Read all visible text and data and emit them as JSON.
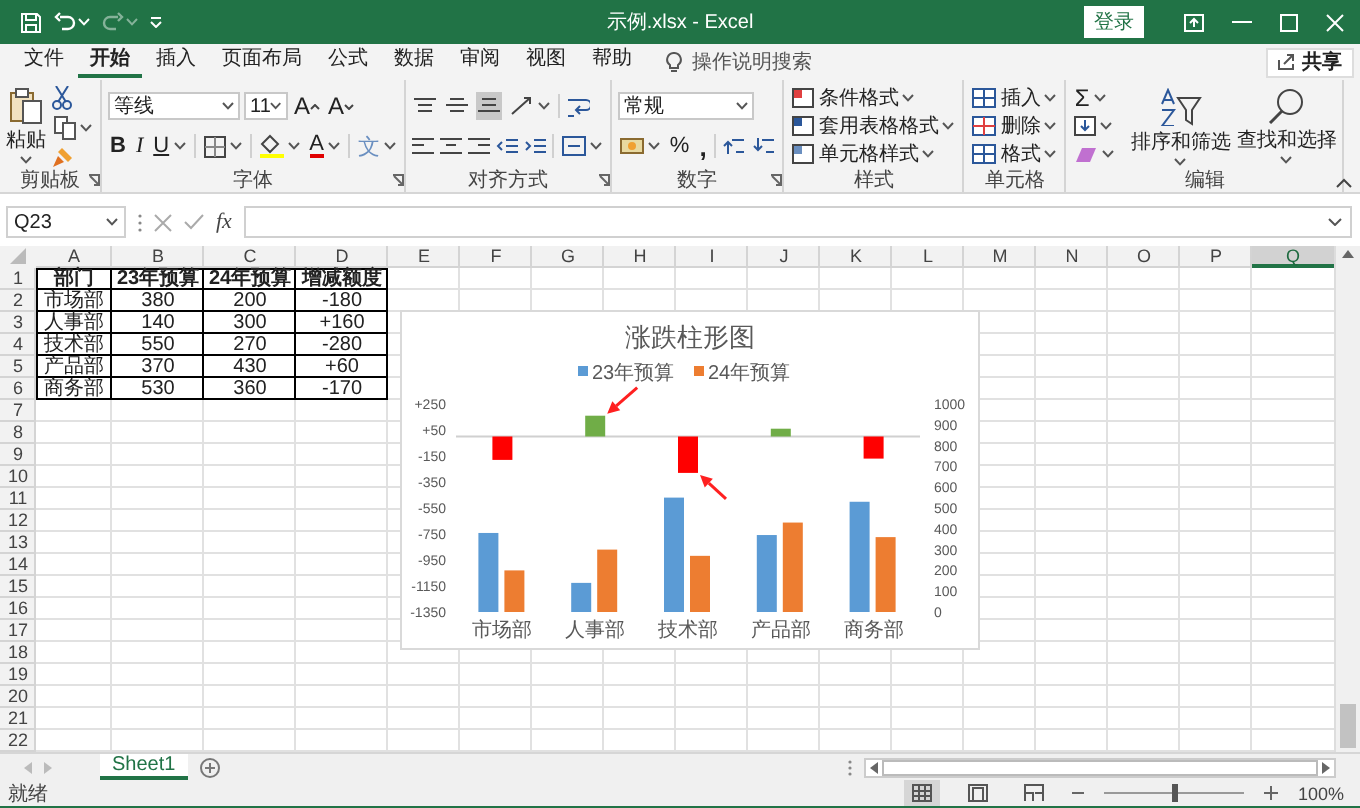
{
  "window": {
    "title": "示例.xlsx  -  Excel",
    "login_button": "登录"
  },
  "menu_tabs": [
    {
      "label": "文件",
      "selected": false
    },
    {
      "label": "开始",
      "selected": true
    },
    {
      "label": "插入",
      "selected": false
    },
    {
      "label": "页面布局",
      "selected": false
    },
    {
      "label": "公式",
      "selected": false
    },
    {
      "label": "数据",
      "selected": false
    },
    {
      "label": "审阅",
      "selected": false
    },
    {
      "label": "视图",
      "selected": false
    },
    {
      "label": "帮助",
      "selected": false
    }
  ],
  "search": {
    "placeholder": "操作说明搜索"
  },
  "share_button": "共享",
  "ribbon_groups": [
    {
      "kind": "clipboard",
      "label": "剪贴板",
      "paste": "粘贴"
    },
    {
      "kind": "font",
      "label": "字体",
      "font_name": "等线",
      "font_size": "11",
      "grow": "A",
      "shrink": "A",
      "bold": "B",
      "italic": "I",
      "underline": "U",
      "font_color": "A",
      "phonetic": "文"
    },
    {
      "kind": "alignment",
      "label": "对齐方式",
      "vertical_align": [
        {
          "selected": false
        },
        {
          "selected": false
        },
        {
          "selected": true
        }
      ]
    },
    {
      "kind": "number",
      "label": "数字",
      "format": "常规",
      "percent": "%",
      "comma": ","
    },
    {
      "kind": "styles",
      "label": "样式",
      "items": [
        "条件格式",
        "套用表格格式",
        "单元格样式"
      ]
    },
    {
      "kind": "cells",
      "label": "单元格",
      "items": [
        "插入",
        "删除",
        "格式"
      ]
    },
    {
      "kind": "editing",
      "label": "编辑",
      "sum": "Σ",
      "sort": "排序和筛选",
      "find": "查找和选择"
    }
  ],
  "formula_bar": {
    "name_box": "Q23",
    "function_label": "fx"
  },
  "sheet": {
    "columns": [
      {
        "label": "A",
        "selected": false
      },
      {
        "label": "B",
        "selected": false
      },
      {
        "label": "C",
        "selected": false
      },
      {
        "label": "D",
        "selected": false
      },
      {
        "label": "E",
        "selected": false
      },
      {
        "label": "F",
        "selected": false
      },
      {
        "label": "G",
        "selected": false
      },
      {
        "label": "H",
        "selected": false
      },
      {
        "label": "I",
        "selected": false
      },
      {
        "label": "J",
        "selected": false
      },
      {
        "label": "K",
        "selected": false
      },
      {
        "label": "L",
        "selected": false
      },
      {
        "label": "M",
        "selected": false
      },
      {
        "label": "N",
        "selected": false
      },
      {
        "label": "O",
        "selected": false
      },
      {
        "label": "P",
        "selected": false
      },
      {
        "label": "Q",
        "selected": true
      }
    ],
    "row_numbers": [
      "1",
      "2",
      "3",
      "4",
      "5",
      "6",
      "7",
      "8",
      "9",
      "10",
      "11",
      "12",
      "13",
      "14",
      "15",
      "16",
      "17",
      "18",
      "19",
      "20",
      "21",
      "22"
    ],
    "rows": [
      [
        "部门",
        "23年预算",
        "24年预算",
        "增减额度"
      ],
      [
        "市场部",
        "380",
        "200",
        "-180"
      ],
      [
        "人事部",
        "140",
        "300",
        "+160"
      ],
      [
        "技术部",
        "550",
        "270",
        "-280"
      ],
      [
        "产品部",
        "370",
        "430",
        "+60"
      ],
      [
        "商务部",
        "530",
        "360",
        "-170"
      ]
    ]
  },
  "chart": {
    "chart_data": {
      "type": "bar",
      "title": "涨跌柱形图",
      "categories": [
        "市场部",
        "人事部",
        "技术部",
        "产品部",
        "商务部"
      ],
      "series": [
        {
          "name": "23年预算",
          "color": "#5b9bd5",
          "axis": "y2",
          "values": [
            380,
            140,
            550,
            370,
            530
          ]
        },
        {
          "name": "24年预算",
          "color": "#ed7d31",
          "axis": "y2",
          "values": [
            200,
            300,
            270,
            430,
            360
          ]
        },
        {
          "color": "#ff0000",
          "values": [
            -180,
            null,
            -280,
            null,
            -170
          ]
        },
        {
          "color": "#70ad47",
          "values": [
            null,
            160,
            null,
            60,
            null
          ]
        }
      ],
      "stacked": false,
      "legend": "top",
      "ylim": [
        -1350,
        250
      ],
      "yticks": [
        {
          "value": 250,
          "label": "+250"
        },
        {
          "value": 50,
          "label": "+50"
        },
        -150,
        -350,
        -550,
        -750,
        -950,
        -1150,
        -1350
      ],
      "y2lim": [
        0,
        1000
      ],
      "y2ticks": [
        0,
        100,
        200,
        300,
        400,
        500,
        600,
        700,
        800,
        900,
        1000
      ],
      "annotations": [
        {
          "x": "人事部"
        },
        {
          "x": "技术部"
        }
      ]
    }
  },
  "sheet_tabs": [
    {
      "label": "Sheet1",
      "selected": true
    }
  ],
  "status_bar": {
    "status": "就绪",
    "views": [
      {
        "selected": true
      },
      {
        "selected": false
      },
      {
        "selected": false
      }
    ],
    "zoom": {
      "level": 0.5,
      "reading": "100%"
    }
  }
}
